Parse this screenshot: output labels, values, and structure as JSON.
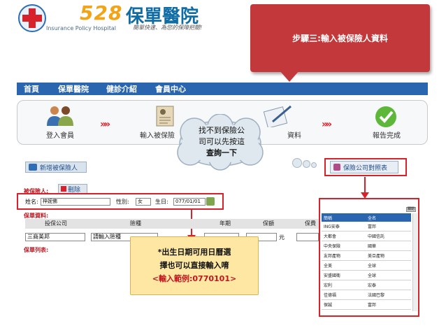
{
  "header": {
    "logo_number": "528",
    "logo_name": "保單醫院",
    "logo_english": "Insurance Policy Hospital",
    "logo_slogan": "簡單快速、為您的保障把關!"
  },
  "callout": {
    "text": "步驟三:輸入被保險人資料"
  },
  "nav": {
    "items": [
      "首頁",
      "保單醫院",
      "健診介紹",
      "會員中心"
    ]
  },
  "steps": {
    "items": [
      {
        "label": "登入會員",
        "icon": "people-icon"
      },
      {
        "label": "輸入被保險",
        "icon": "document-icon"
      },
      {
        "label": "資料",
        "icon": "pen-paper-icon"
      },
      {
        "label": "報告完成",
        "icon": "check-icon"
      }
    ],
    "arrow_glyph": "»»"
  },
  "cloud": {
    "line1": "找不到保險公",
    "line2": "司可以先按這",
    "line3": "查詢一下"
  },
  "buttons": {
    "add_insured": "新增被保險人",
    "compare_table": "保險公司對照表",
    "delete": "刪除"
  },
  "form": {
    "insured_label": "被保險人:",
    "name_label": "姓名:",
    "name_value": "梓妮佛",
    "gender_label": "性別:",
    "gender_value": "女",
    "birth_label": "生日:",
    "birth_value": "077/01/01",
    "policy_data_label": "保單資料:",
    "policy_list_label": "保單列表:"
  },
  "table": {
    "headers": [
      "投保公司",
      "險種",
      "年期",
      "保額",
      "保費"
    ],
    "company_value": "三商美邦",
    "type_placeholder": "請輸入險種",
    "amount_unit": "元"
  },
  "note": {
    "line1": "*出生日期可用日曆選",
    "line2": "擇也可以直接輸入唷",
    "example": "<輸入範例:0770101>"
  },
  "compare_panel": {
    "close_label": "關閉",
    "headers": [
      "簡稱",
      "全名"
    ],
    "rows": [
      [
        "ING安泰",
        "富邦"
      ],
      [
        "大都會",
        "中國信託"
      ],
      [
        "中央保險",
        "國華"
      ],
      [
        "友邦產物",
        "美亞產物"
      ],
      [
        "全美",
        "全球"
      ],
      [
        "安盛國衛",
        "全球"
      ],
      [
        "宏利",
        "宏泰"
      ],
      [
        "佳德福",
        "法國巴黎"
      ],
      [
        "保誠",
        "富邦"
      ]
    ]
  },
  "colors": {
    "accent_red": "#d8222b",
    "nav_blue": "#2a66b0",
    "callout_red": "#c2383b",
    "note_yellow": "#fde7a3",
    "logo_orange": "#f2a316"
  }
}
